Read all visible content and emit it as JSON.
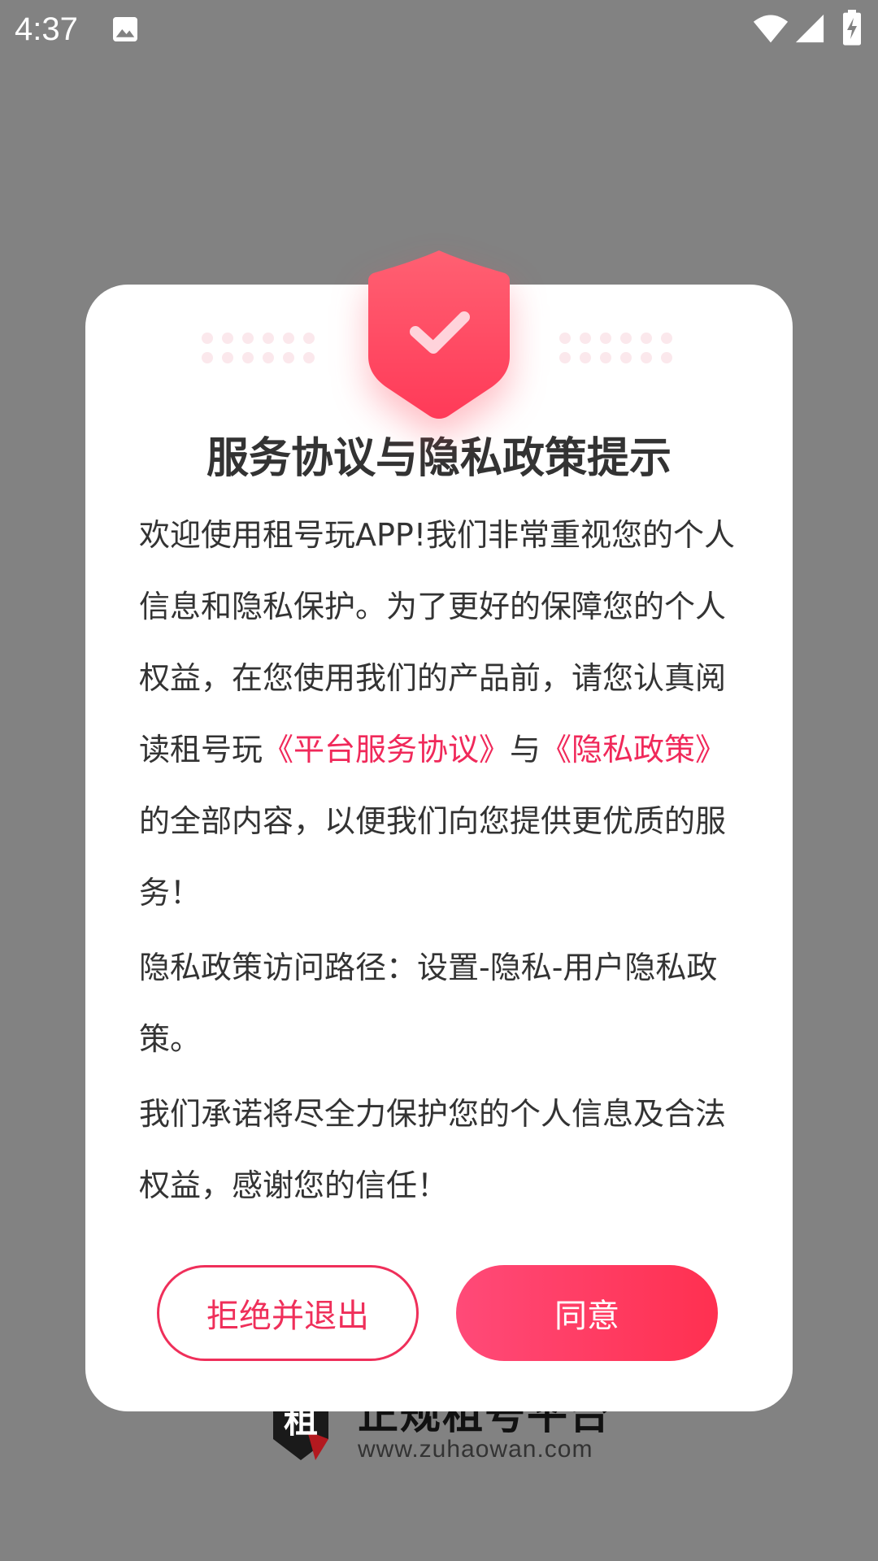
{
  "status_bar": {
    "time": "4:37",
    "icons": [
      "image-icon",
      "wifi-icon",
      "signal-icon",
      "battery-charging-icon"
    ]
  },
  "background": {
    "logo_title": "正规租号平台",
    "logo_url": "www.zuhaowan.com",
    "logo_mark_text": "租"
  },
  "dialog": {
    "icon": "shield-check-icon",
    "title": "服务协议与隐私政策提示",
    "paragraph1": {
      "text_before": "欢迎使用租号玩APP!我们非常重视您的个人信息和隐私保护。为了更好的保障您的个人权益，在您使用我们的产品前，请您认真阅读租号玩",
      "link_service": "《平台服务协议》",
      "text_middle": "与",
      "link_privacy": "《隐私政策》",
      "text_after": "的全部内容，以便我们向您提供更优质的服务！"
    },
    "paragraph2": "隐私政策访问路径：设置-隐私-用户隐私政策。",
    "paragraph3": "我们承诺将尽全力保护您的个人信息及合法权益，感谢您的信任！",
    "reject_label": "拒绝并退出",
    "agree_label": "同意"
  },
  "colors": {
    "accent": "#f0295a",
    "overlay": "#828282",
    "dialog_bg": "#ffffff",
    "text": "#333333"
  }
}
